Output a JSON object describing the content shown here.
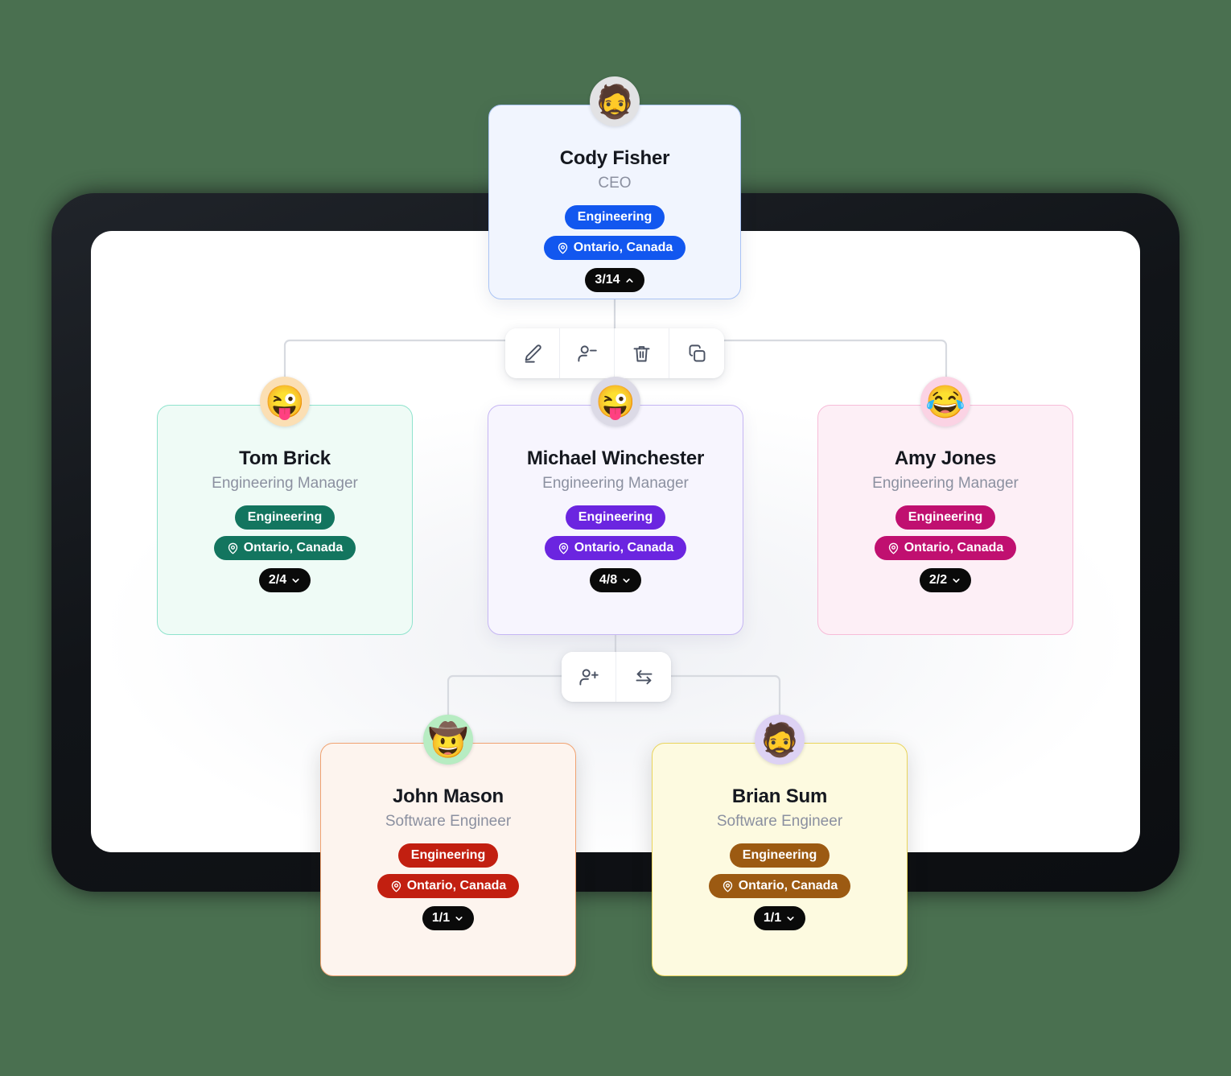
{
  "background_color": "#4a7050",
  "device": {
    "bezel_color": "#111418",
    "screen_color": "#ffffff"
  },
  "connector_color": "#d7dae0",
  "org_chart": {
    "location_icon": "map-pin-icon",
    "nodes": [
      {
        "id": "cody-fisher",
        "name": "Cody Fisher",
        "title": "CEO",
        "department": "Engineering",
        "location": "Ontario, Canada",
        "count": "3/14",
        "expanded": true,
        "chevron": "chevron-up-icon",
        "avatar_emoji": "🧔",
        "avatar_bg": "#e2e2e4",
        "card_bg": "#f1f5fe",
        "card_border": "#aac4f5",
        "accent": "#1257ef"
      },
      {
        "id": "tom-brick",
        "name": "Tom Brick",
        "title": "Engineering Manager",
        "department": "Engineering",
        "location": "Ontario, Canada",
        "count": "2/4",
        "expanded": false,
        "chevron": "chevron-down-icon",
        "avatar_emoji": "😜",
        "avatar_bg": "#fbdfb4",
        "card_bg": "#effbf6",
        "card_border": "#8fe3cd",
        "accent": "#13755f"
      },
      {
        "id": "michael-winchester",
        "name": "Michael Winchester",
        "title": "Engineering Manager",
        "department": "Engineering",
        "location": "Ontario, Canada",
        "count": "4/8",
        "expanded": false,
        "chevron": "chevron-down-icon",
        "avatar_emoji": "😜",
        "avatar_bg": "#dcdae6",
        "card_bg": "#f7f5fe",
        "card_border": "#c5b6f3",
        "accent": "#6b25e0"
      },
      {
        "id": "amy-jones",
        "name": "Amy Jones",
        "title": "Engineering Manager",
        "department": "Engineering",
        "location": "Ontario, Canada",
        "count": "2/2",
        "expanded": false,
        "chevron": "chevron-down-icon",
        "avatar_emoji": "😂",
        "avatar_bg": "#fbd3e4",
        "card_bg": "#fdeff6",
        "card_border": "#f7bcd8",
        "accent": "#c01070"
      },
      {
        "id": "john-mason",
        "name": "John Mason",
        "title": "Software Engineer",
        "department": "Engineering",
        "location": "Ontario, Canada",
        "count": "1/1",
        "expanded": false,
        "chevron": "chevron-down-icon",
        "avatar_emoji": "🤠",
        "avatar_bg": "#b7ecc2",
        "card_bg": "#fdf4ee",
        "card_border": "#f0a271",
        "accent": "#c21f10"
      },
      {
        "id": "brian-sum",
        "name": "Brian Sum",
        "title": "Software Engineer",
        "department": "Engineering",
        "location": "Ontario, Canada",
        "count": "1/1",
        "expanded": false,
        "chevron": "chevron-down-icon",
        "avatar_emoji": "🧔",
        "avatar_bg": "#ddd2f4",
        "card_bg": "#fdfae0",
        "card_border": "#e9d45c",
        "accent": "#9c5a12"
      }
    ]
  },
  "toolbars": {
    "primary": {
      "buttons": [
        {
          "id": "edit",
          "icon": "pencil-edit-icon",
          "label": "Edit"
        },
        {
          "id": "remove-user",
          "icon": "user-minus-icon",
          "label": "Remove employee"
        },
        {
          "id": "delete",
          "icon": "trash-icon",
          "label": "Delete"
        },
        {
          "id": "duplicate",
          "icon": "copy-icon",
          "label": "Duplicate"
        }
      ]
    },
    "secondary": {
      "buttons": [
        {
          "id": "add-user",
          "icon": "user-plus-icon",
          "label": "Add employee"
        },
        {
          "id": "transfer",
          "icon": "swap-arrows-icon",
          "label": "Transfer"
        }
      ]
    }
  }
}
